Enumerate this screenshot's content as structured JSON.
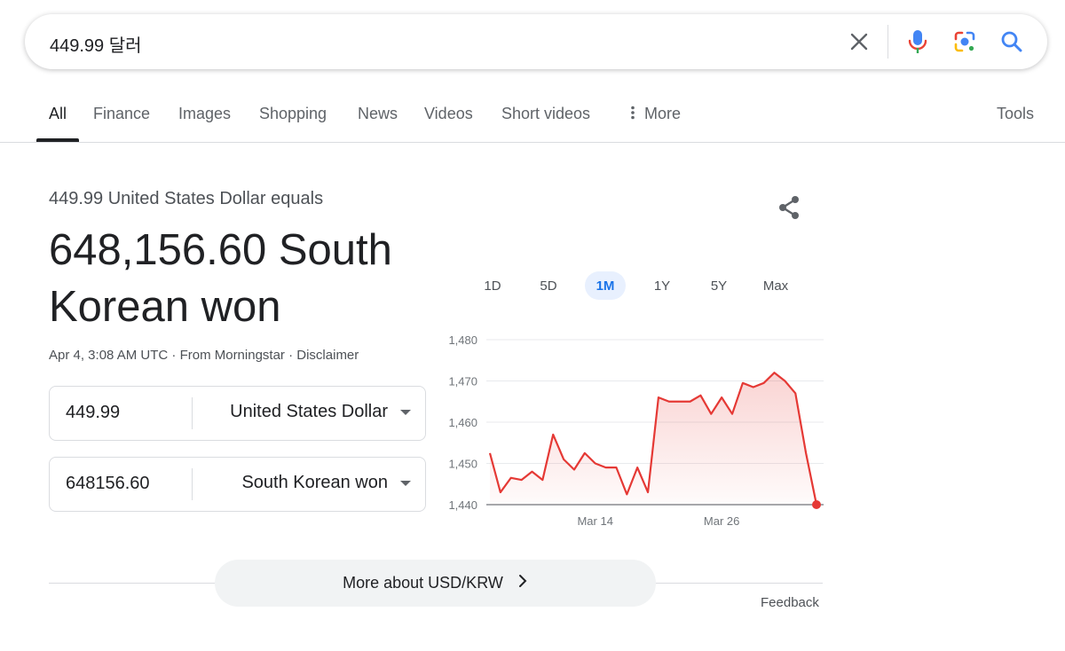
{
  "search": {
    "query": "449.99 달러"
  },
  "tabs": [
    {
      "label": "All"
    },
    {
      "label": "Finance"
    },
    {
      "label": "Images"
    },
    {
      "label": "Shopping"
    },
    {
      "label": "News"
    },
    {
      "label": "Videos"
    },
    {
      "label": "Short videos"
    },
    {
      "label": "More"
    }
  ],
  "tools_label": "Tools",
  "result": {
    "equals_text": "449.99 United States Dollar equals",
    "converted_text": "648,156.60 South Korean won",
    "timestamp": "Apr 4, 3:08 AM UTC",
    "source": "From Morningstar",
    "disclaimer": "Disclaimer",
    "separator": "·"
  },
  "converter": {
    "from": {
      "amount": "449.99",
      "currency": "United States Dollar"
    },
    "to": {
      "amount": "648156.60",
      "currency": "South Korean won"
    }
  },
  "ranges": [
    "1D",
    "5D",
    "1M",
    "1Y",
    "5Y",
    "Max"
  ],
  "active_range": "1M",
  "more_button_label": "More about USD/KRW",
  "feedback_label": "Feedback",
  "colors": {
    "line": "#e53935",
    "accent": "#1a73e8",
    "active_range_bg": "#e8f0fe"
  },
  "chart_data": {
    "type": "area",
    "x_tick_labels": [
      "Mar 14",
      "Mar 26"
    ],
    "y_ticks": [
      1440,
      1450,
      1460,
      1470,
      1480
    ],
    "ylim": [
      1440,
      1480
    ],
    "grid": true,
    "series": [
      {
        "values": [
          1452.5,
          1443,
          1446.5,
          1446,
          1448,
          1446,
          1457,
          1451,
          1448.5,
          1452.5,
          1450,
          1449,
          1449,
          1442.5,
          1449,
          1443,
          1466,
          1465,
          1465,
          1465,
          1466.5,
          1462,
          1466,
          1462,
          1469.5,
          1468.5,
          1469.5,
          1472,
          1470,
          1467,
          1452.5,
          1440
        ]
      }
    ],
    "x_tick_index": [
      10,
      22
    ]
  }
}
